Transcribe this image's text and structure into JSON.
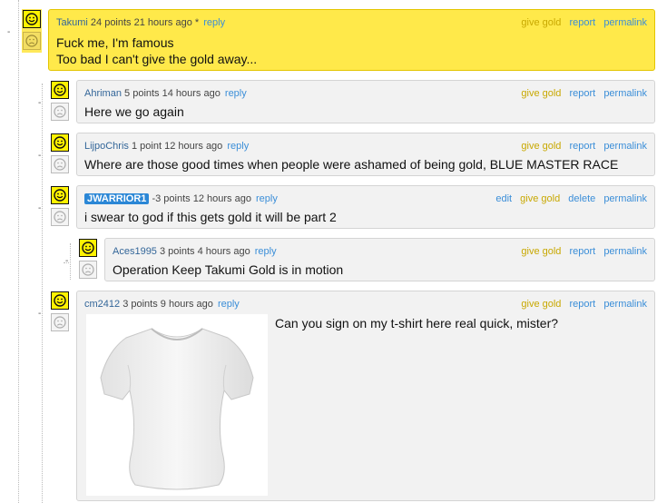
{
  "comments": [
    {
      "author": "Takumi",
      "points": "24 points",
      "time": "21 hours ago *",
      "reply": "reply",
      "actions": [
        "give gold",
        "report",
        "permalink"
      ],
      "body_lines": [
        "Fuck me, I'm famous",
        "Too bad I can't give the gold away..."
      ],
      "gilded": true
    },
    {
      "author": "Ahriman",
      "points": "5 points",
      "time": "14 hours ago",
      "reply": "reply",
      "actions": [
        "give gold",
        "report",
        "permalink"
      ],
      "body_lines": [
        "Here we go again"
      ]
    },
    {
      "author": "LijpoChris",
      "points": "1 point",
      "time": "12 hours ago",
      "reply": "reply",
      "actions": [
        "give gold",
        "report",
        "permalink"
      ],
      "body_lines": [
        "Where are those good times when people were ashamed of being gold, BLUE MASTER RACE"
      ]
    },
    {
      "author": "JWARRIOR1",
      "points": "-3 points",
      "time": "12 hours ago",
      "reply": "reply",
      "actions": [
        "edit",
        "give gold",
        "delete",
        "permalink"
      ],
      "body_lines": [
        "i swear to god if this gets gold it will be part 2"
      ]
    },
    {
      "author": "Aces1995",
      "points": "3 points",
      "time": "4 hours ago",
      "reply": "reply",
      "actions": [
        "give gold",
        "report",
        "permalink"
      ],
      "body_lines": [
        "Operation Keep Takumi Gold is in motion"
      ]
    },
    {
      "author": "cm2412",
      "points": "3 points",
      "time": "9 hours ago",
      "reply": "reply",
      "actions": [
        "give gold",
        "report",
        "permalink"
      ],
      "body_lines": [
        "Can you sign on my t-shirt here real quick, mister?"
      ]
    }
  ],
  "collapse_marker": "-",
  "icons": {
    "upvote": "smiley-face-icon",
    "downvote": "frown-face-icon",
    "image": "white-tshirt-image"
  },
  "colors": {
    "gold_bg": "#ffe94a",
    "comment_bg": "#f2f2f2",
    "link": "#3b8ed8",
    "give_gold": "#c8a800",
    "flair_bg": "#2b87d6"
  }
}
